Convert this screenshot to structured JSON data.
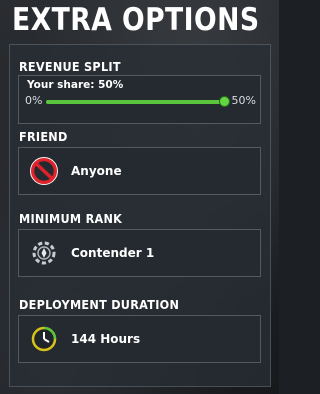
{
  "header": {
    "title": "EXTRA OPTIONS"
  },
  "revenue_split": {
    "label": "REVENUE SPLIT",
    "share_text": "Your share: 50%",
    "min_label": "0%",
    "max_label": "50%",
    "value_fraction": 1.0
  },
  "friend": {
    "label": "FRIEND",
    "value": "Anyone",
    "icon": "no-entry-icon"
  },
  "minimum_rank": {
    "label": "MINIMUM RANK",
    "value": "Contender 1",
    "icon": "rank-gear-icon"
  },
  "deployment_duration": {
    "label": "DEPLOYMENT DURATION",
    "value": "144 Hours",
    "icon": "clock-icon"
  },
  "colors": {
    "accent_green": "#5ac43c",
    "no_entry_red": "#e0232b",
    "clock_yellow": "#d8c21a"
  }
}
